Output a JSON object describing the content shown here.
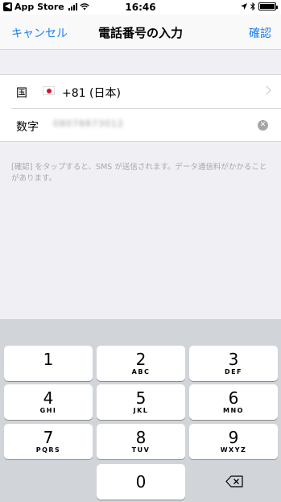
{
  "status_bar": {
    "back_app": "App Store",
    "time": "16:46"
  },
  "nav": {
    "cancel_label": "キャンセル",
    "title": "電話番号の入力",
    "confirm_label": "確認"
  },
  "form": {
    "country_label": "国",
    "country_code": "+81 (日本)",
    "number_label": "数字",
    "number_value": "08078873012"
  },
  "notice": "[確認] をタップすると、SMS が送信されます。データ通信料がかかることがあります。",
  "keypad": {
    "keys": [
      {
        "digit": "1",
        "letters": ""
      },
      {
        "digit": "2",
        "letters": "ABC"
      },
      {
        "digit": "3",
        "letters": "DEF"
      },
      {
        "digit": "4",
        "letters": "GHI"
      },
      {
        "digit": "5",
        "letters": "JKL"
      },
      {
        "digit": "6",
        "letters": "MNO"
      },
      {
        "digit": "7",
        "letters": "PQRS"
      },
      {
        "digit": "8",
        "letters": "TUV"
      },
      {
        "digit": "9",
        "letters": "WXYZ"
      },
      {
        "digit": "0",
        "letters": ""
      }
    ]
  },
  "icons": {
    "flag": "japan-flag-icon",
    "chevron": "chevron-right-icon",
    "clear": "clear-icon",
    "delete": "backspace-icon"
  },
  "colors": {
    "accent": "#1b7ff5",
    "background": "#efeff4",
    "keypad_background": "#d1d4d9"
  }
}
